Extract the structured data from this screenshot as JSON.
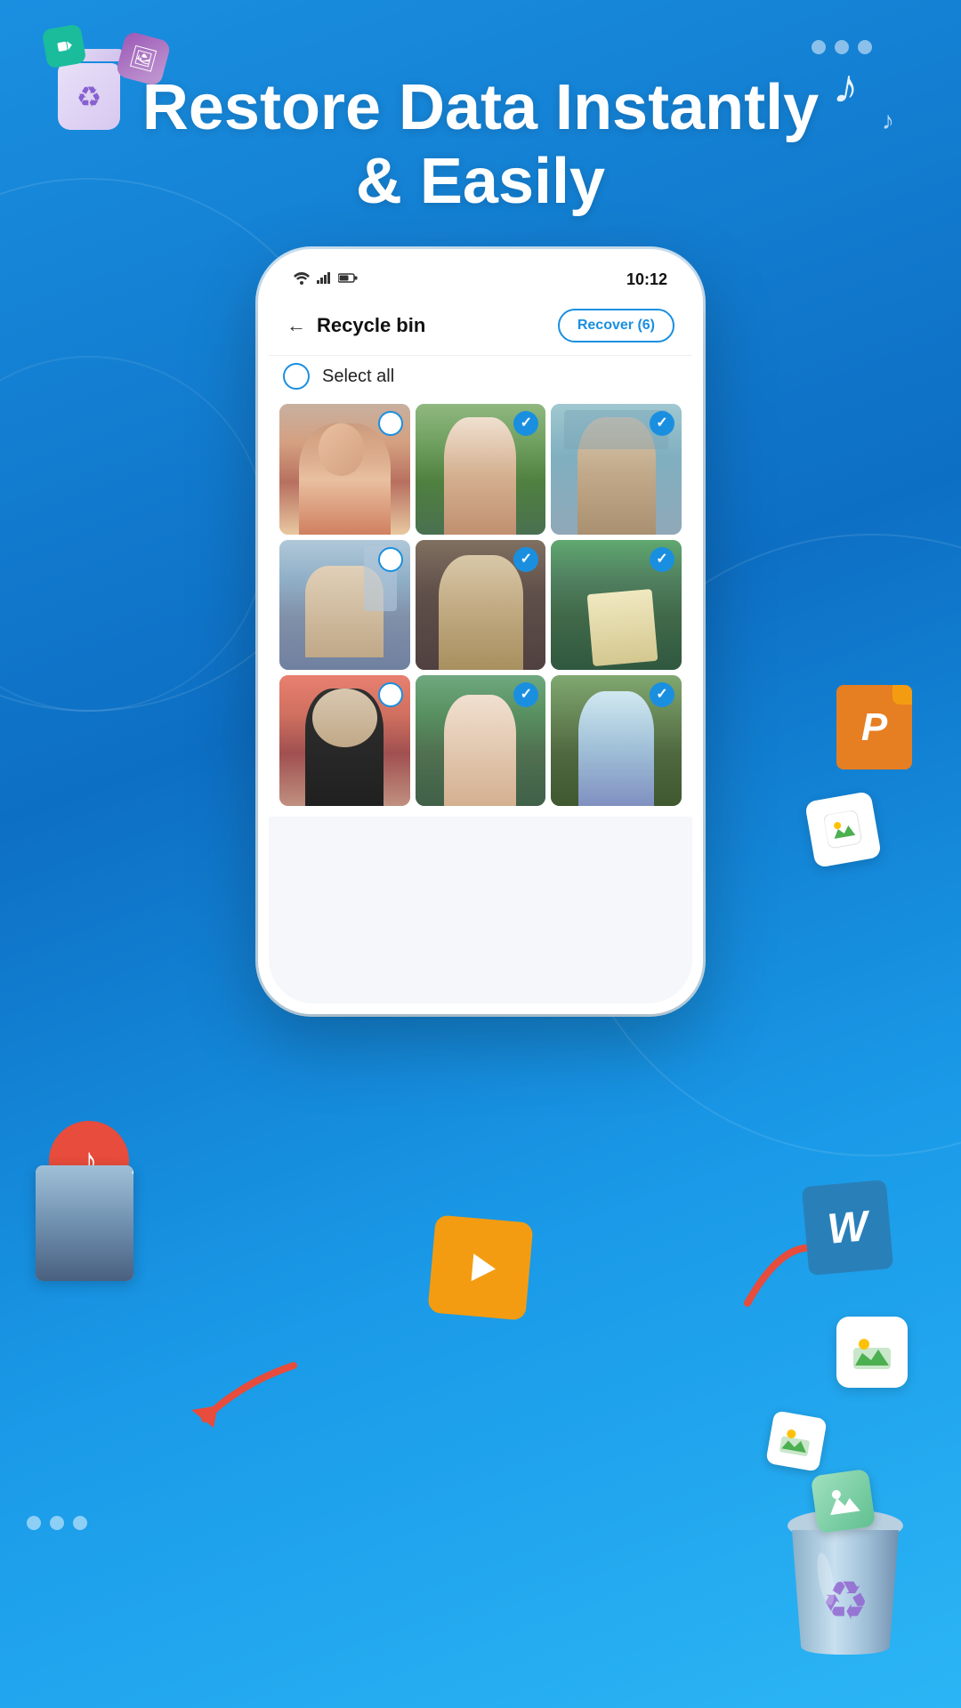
{
  "header": {
    "title": "Restore Data\nInstantly & Easily"
  },
  "status_bar": {
    "time": "10:12",
    "wifi": "📶",
    "signal": "📶",
    "battery": "🔋"
  },
  "app_bar": {
    "back_label": "←",
    "title": "Recycle bin",
    "recover_button": "Recover (6)"
  },
  "select_all": {
    "label": "Select all"
  },
  "photos": [
    {
      "id": 1,
      "checked": false,
      "color_class": "photo-1"
    },
    {
      "id": 2,
      "checked": true,
      "color_class": "photo-2"
    },
    {
      "id": 3,
      "checked": true,
      "color_class": "photo-3"
    },
    {
      "id": 4,
      "checked": false,
      "color_class": "photo-4"
    },
    {
      "id": 5,
      "checked": true,
      "color_class": "photo-5"
    },
    {
      "id": 6,
      "checked": true,
      "color_class": "photo-6"
    },
    {
      "id": 7,
      "checked": false,
      "color_class": "photo-7"
    },
    {
      "id": 8,
      "checked": true,
      "color_class": "photo-8"
    },
    {
      "id": 9,
      "checked": true,
      "color_class": "photo-9"
    }
  ],
  "icons": {
    "recycle": "♻",
    "music_note": "♪",
    "image": "🖼",
    "video": "▶",
    "ppt_letter": "P",
    "word_letter": "W",
    "check": "✓"
  },
  "colors": {
    "primary": "#1a8fe0",
    "accent_red": "#e74c3c",
    "accent_orange": "#f39c12",
    "accent_purple": "#8860d0",
    "white": "#ffffff"
  }
}
